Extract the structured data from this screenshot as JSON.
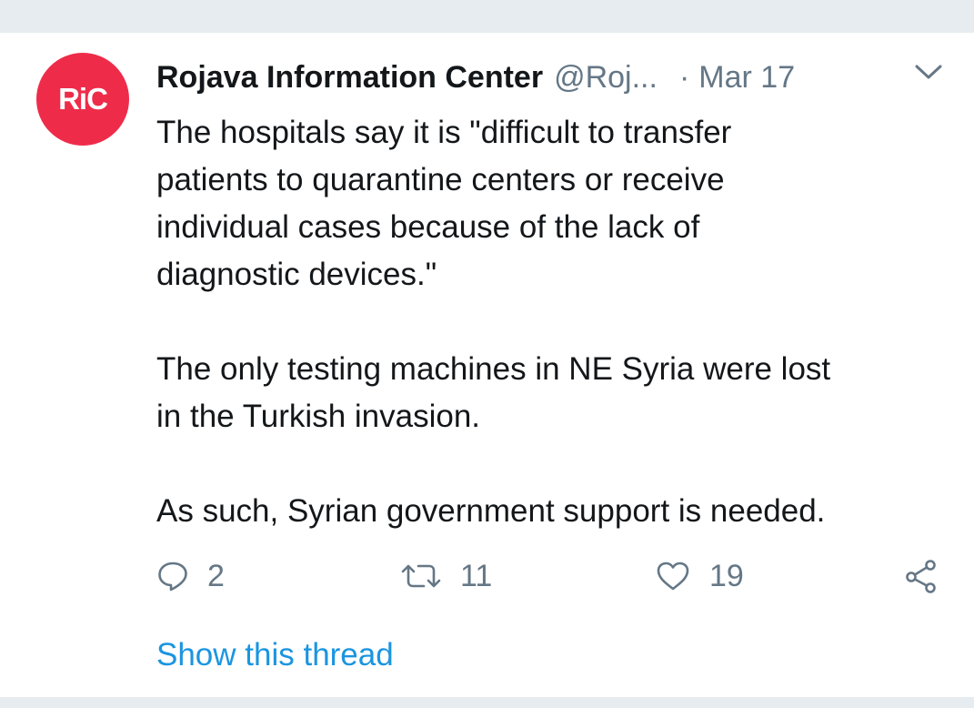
{
  "tweet": {
    "avatar_text": "RiC",
    "display_name": "Rojava Information Center",
    "handle": "@Roj...",
    "separator": "·",
    "date": "Mar 17",
    "paragraphs": [
      "The hospitals say it is \"difficult to transfer\npatients to quarantine centers or receive\nindividual cases because of the lack of\ndiagnostic devices.\"",
      "The only testing machines in NE Syria were lost\nin the Turkish invasion.",
      "As such, Syrian government support is needed."
    ],
    "actions": {
      "reply_count": "2",
      "retweet_count": "11",
      "like_count": "19"
    },
    "show_thread_label": "Show this thread"
  },
  "colors": {
    "avatar_bg": "#ee2c4a",
    "secondary_text": "#657786",
    "link": "#1b95e0",
    "divider": "#e6ecf0"
  },
  "icons": {
    "reply": "reply-icon",
    "retweet": "retweet-icon",
    "like": "heart-icon",
    "share": "share-icon",
    "menu": "chevron-down-icon"
  }
}
